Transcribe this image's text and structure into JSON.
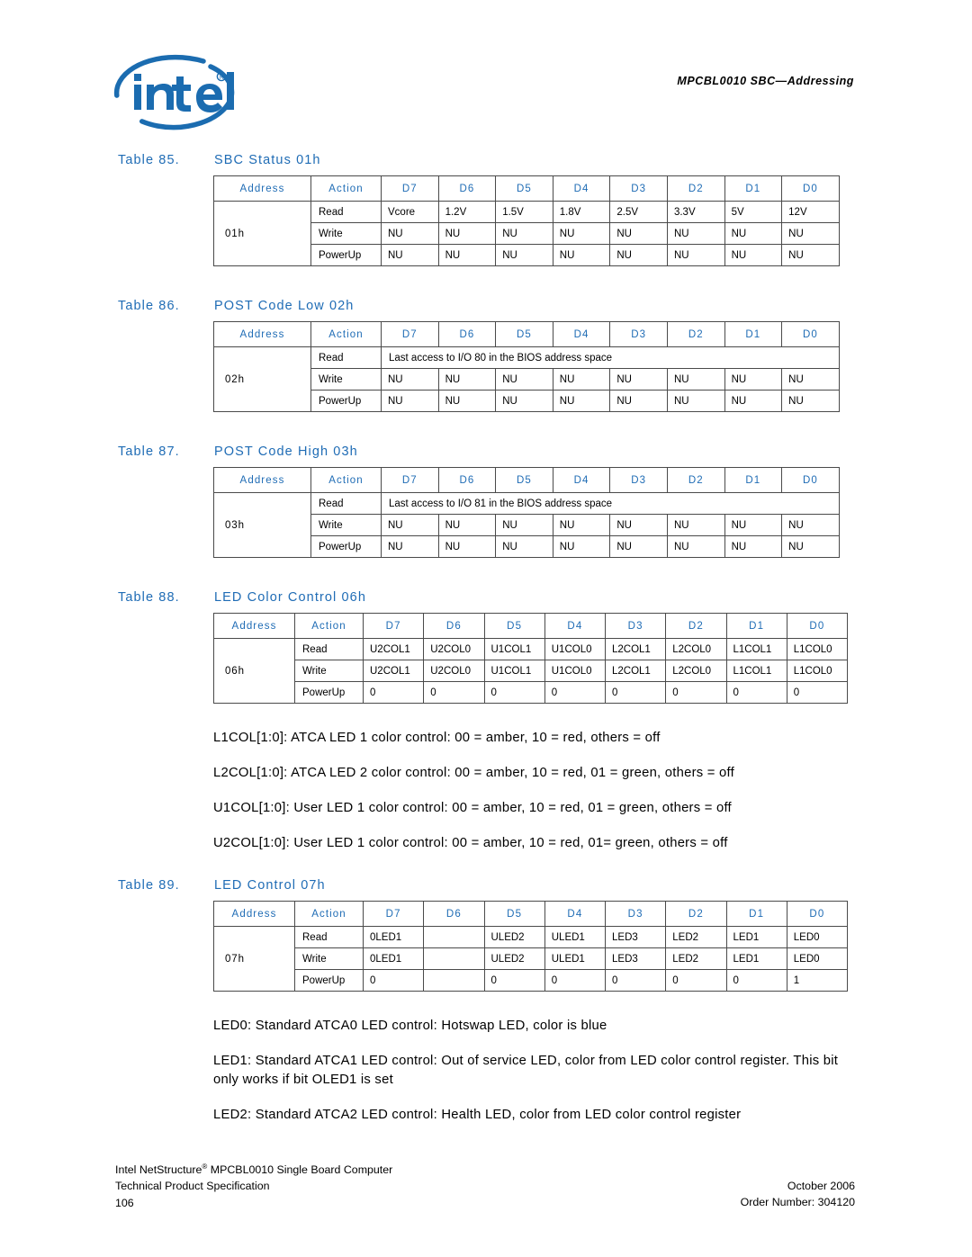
{
  "header": {
    "running_head": "MPCBL0010 SBC—Addressing",
    "logo_text": "intel",
    "logo_reg": "®",
    "logo_color": "#1b6cb0"
  },
  "theme": {
    "accent_blue": "#1f6cb5",
    "table_border": "#4a4a4a",
    "text": "#000000"
  },
  "tables": [
    {
      "caption_number": "Table 85.",
      "caption_title": "SBC Status 01h",
      "columns": [
        "Address",
        "Action",
        "D7",
        "D6",
        "D5",
        "D4",
        "D3",
        "D2",
        "D1",
        "D0"
      ],
      "address": "01h",
      "rows": [
        {
          "action": "Read",
          "span": false,
          "cells": [
            "Vcore",
            "1.2V",
            "1.5V",
            "1.8V",
            "2.5V",
            "3.3V",
            "5V",
            "12V"
          ]
        },
        {
          "action": "Write",
          "span": false,
          "cells": [
            "NU",
            "NU",
            "NU",
            "NU",
            "NU",
            "NU",
            "NU",
            "NU"
          ]
        },
        {
          "action": "PowerUp",
          "span": false,
          "cells": [
            "NU",
            "NU",
            "NU",
            "NU",
            "NU",
            "NU",
            "NU",
            "NU"
          ]
        }
      ]
    },
    {
      "caption_number": "Table 86.",
      "caption_title": "POST Code Low 02h",
      "columns": [
        "Address",
        "Action",
        "D7",
        "D6",
        "D5",
        "D4",
        "D3",
        "D2",
        "D1",
        "D0"
      ],
      "address": "02h",
      "rows": [
        {
          "action": "Read",
          "span": true,
          "span_text": "Last access to I/O 80 in the BIOS address space",
          "cells": []
        },
        {
          "action": "Write",
          "span": false,
          "cells": [
            "NU",
            "NU",
            "NU",
            "NU",
            "NU",
            "NU",
            "NU",
            "NU"
          ]
        },
        {
          "action": "PowerUp",
          "span": false,
          "cells": [
            "NU",
            "NU",
            "NU",
            "NU",
            "NU",
            "NU",
            "NU",
            "NU"
          ]
        }
      ]
    },
    {
      "caption_number": "Table 87.",
      "caption_title": "POST Code High 03h",
      "columns": [
        "Address",
        "Action",
        "D7",
        "D6",
        "D5",
        "D4",
        "D3",
        "D2",
        "D1",
        "D0"
      ],
      "address": "03h",
      "rows": [
        {
          "action": "Read",
          "span": true,
          "span_text": "Last access to I/O 81 in the BIOS address space",
          "cells": []
        },
        {
          "action": "Write",
          "span": false,
          "cells": [
            "NU",
            "NU",
            "NU",
            "NU",
            "NU",
            "NU",
            "NU",
            "NU"
          ]
        },
        {
          "action": "PowerUp",
          "span": false,
          "cells": [
            "NU",
            "NU",
            "NU",
            "NU",
            "NU",
            "NU",
            "NU",
            "NU"
          ]
        }
      ]
    },
    {
      "caption_number": "Table 88.",
      "caption_title": "LED Color Control 06h",
      "columns": [
        "Address",
        "Action",
        "D7",
        "D6",
        "D5",
        "D4",
        "D3",
        "D2",
        "D1",
        "D0"
      ],
      "address": "06h",
      "rows": [
        {
          "action": "Read",
          "span": false,
          "cells": [
            "U2COL1",
            "U2COL0",
            "U1COL1",
            "U1COL0",
            "L2COL1",
            "L2COL0",
            "L1COL1",
            "L1COL0"
          ]
        },
        {
          "action": "Write",
          "span": false,
          "cells": [
            "U2COL1",
            "U2COL0",
            "U1COL1",
            "U1COL0",
            "L2COL1",
            "L2COL0",
            "L1COL1",
            "L1COL0"
          ]
        },
        {
          "action": "PowerUp",
          "span": false,
          "cells": [
            "0",
            "0",
            "0",
            "0",
            "0",
            "0",
            "0",
            "0"
          ]
        }
      ]
    },
    {
      "caption_number": "Table 89.",
      "caption_title": "LED Control 07h",
      "columns": [
        "Address",
        "Action",
        "D7",
        "D6",
        "D5",
        "D4",
        "D3",
        "D2",
        "D1",
        "D0"
      ],
      "address": "07h",
      "rows": [
        {
          "action": "Read",
          "span": false,
          "cells": [
            "0LED1",
            "",
            "ULED2",
            "ULED1",
            "LED3",
            "LED2",
            "LED1",
            "LED0"
          ]
        },
        {
          "action": "Write",
          "span": false,
          "cells": [
            "0LED1",
            "",
            "ULED2",
            "ULED1",
            "LED3",
            "LED2",
            "LED1",
            "LED0"
          ]
        },
        {
          "action": "PowerUp",
          "span": false,
          "cells": [
            "0",
            "",
            "0",
            "0",
            "0",
            "0",
            "0",
            "1"
          ]
        }
      ]
    }
  ],
  "notes_led_color": [
    "L1COL[1:0]: ATCA LED 1 color control: 00 = amber, 10 = red, others = off",
    "L2COL[1:0]: ATCA LED 2 color control: 00 = amber, 10 = red, 01 = green, others = off",
    "U1COL[1:0]: User LED 1 color control: 00 = amber, 10 = red, 01 = green, others = off",
    "U2COL[1:0]: User LED 1 color control: 00 = amber, 10 = red, 01= green, others = off"
  ],
  "notes_led_control": [
    "LED0: Standard ATCA0 LED control: Hotswap LED, color is blue",
    "LED1: Standard ATCA1 LED control: Out of service LED, color from LED color control register. This bit only works if bit OLED1 is set",
    "LED2: Standard ATCA2 LED control: Health LED, color from LED color control register"
  ],
  "footer": {
    "line1_pre": "Intel NetStructure",
    "line1_reg": "®",
    "line1_post": " MPCBL0010 Single Board Computer",
    "line2": "Technical Product Specification",
    "page_number": "106",
    "date": "October 2006",
    "order_number": "Order Number: 304120"
  }
}
